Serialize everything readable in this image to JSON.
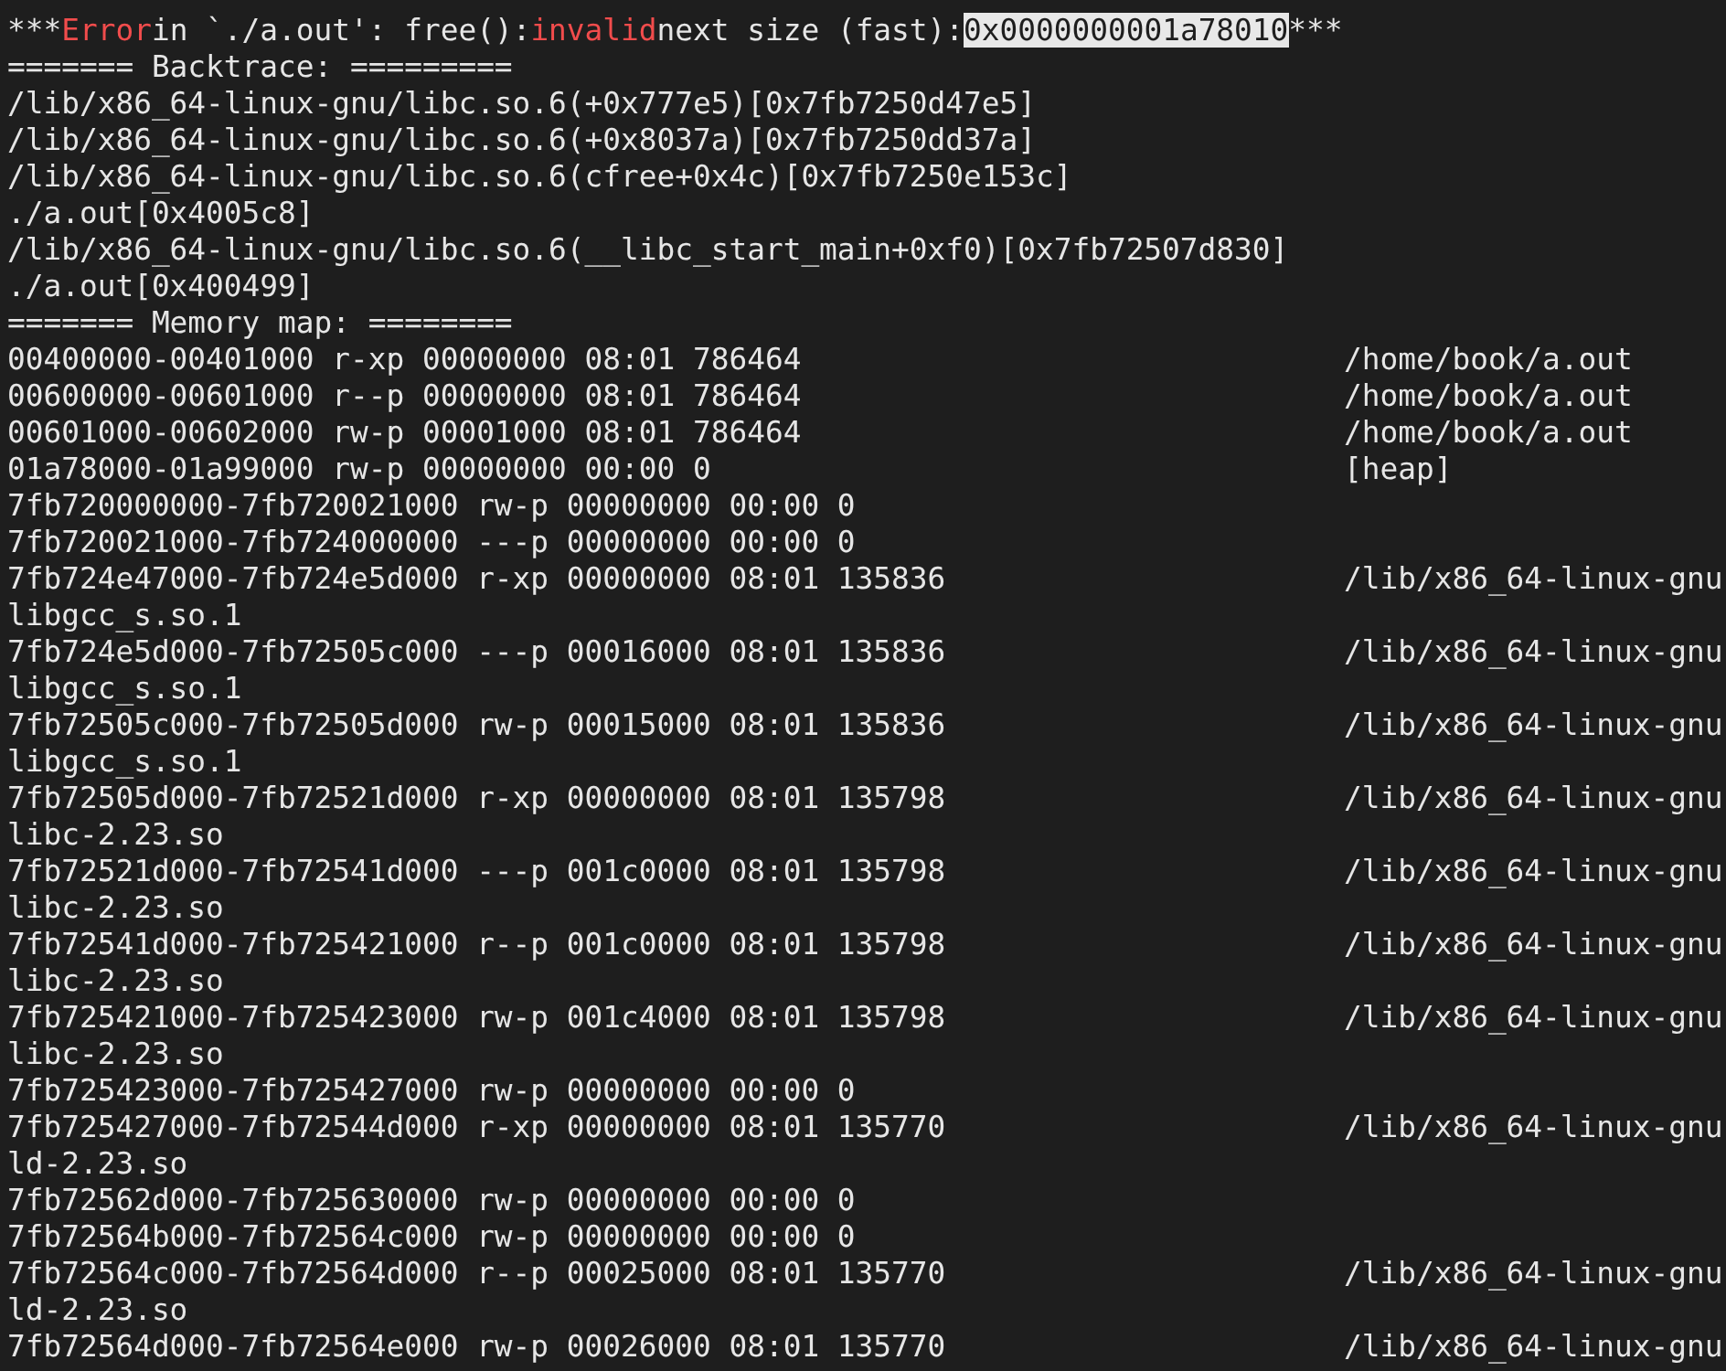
{
  "terminal": {
    "error_line": [
      {
        "text": "***",
        "kind": "plain"
      },
      {
        "text": "Error",
        "kind": "error"
      },
      {
        "text": "in `./a.out': free():",
        "kind": "plain"
      },
      {
        "text": "invalid",
        "kind": "error"
      },
      {
        "text": "next size (fast):",
        "kind": "plain"
      },
      {
        "text": "0x0000000001a78010",
        "kind": "selected"
      },
      {
        "text": "***",
        "kind": "plain"
      }
    ],
    "backtrace": [
      "======= Backtrace: =========",
      "/lib/x86_64-linux-gnu/libc.so.6(+0x777e5)[0x7fb7250d47e5]",
      "/lib/x86_64-linux-gnu/libc.so.6(+0x8037a)[0x7fb7250dd37a]",
      "/lib/x86_64-linux-gnu/libc.so.6(cfree+0x4c)[0x7fb7250e153c]",
      "./a.out[0x4005c8]",
      "/lib/x86_64-linux-gnu/libc.so.6(__libc_start_main+0xf0)[0x7fb72507d830]",
      "./a.out[0x400499]",
      "======= Memory map: ========"
    ],
    "memory_map": [
      {
        "mapping": "00400000-00401000 r-xp 00000000 08:01 786464",
        "path": "/home/book/a.out"
      },
      {
        "mapping": "00600000-00601000 r--p 00000000 08:01 786464",
        "path": "/home/book/a.out"
      },
      {
        "mapping": "00601000-00602000 rw-p 00001000 08:01 786464",
        "path": "/home/book/a.out"
      },
      {
        "mapping": "01a78000-01a99000 rw-p 00000000 00:00 0",
        "path": "[heap]"
      },
      {
        "mapping": "7fb720000000-7fb720021000 rw-p 00000000 00:00 0"
      },
      {
        "mapping": "7fb720021000-7fb724000000 ---p 00000000 00:00 0"
      },
      {
        "mapping": "7fb724e47000-7fb724e5d000 r-xp 00000000 08:01 135836",
        "path": "/lib/x86_64-linux-gnu",
        "wrap": "libgcc_s.so.1"
      },
      {
        "mapping": "7fb724e5d000-7fb72505c000 ---p 00016000 08:01 135836",
        "path": "/lib/x86_64-linux-gnu",
        "wrap": "libgcc_s.so.1"
      },
      {
        "mapping": "7fb72505c000-7fb72505d000 rw-p 00015000 08:01 135836",
        "path": "/lib/x86_64-linux-gnu",
        "wrap": "libgcc_s.so.1"
      },
      {
        "mapping": "7fb72505d000-7fb72521d000 r-xp 00000000 08:01 135798",
        "path": "/lib/x86_64-linux-gnu",
        "wrap": "libc-2.23.so"
      },
      {
        "mapping": "7fb72521d000-7fb72541d000 ---p 001c0000 08:01 135798",
        "path": "/lib/x86_64-linux-gnu",
        "wrap": "libc-2.23.so"
      },
      {
        "mapping": "7fb72541d000-7fb725421000 r--p 001c0000 08:01 135798",
        "path": "/lib/x86_64-linux-gnu",
        "wrap": "libc-2.23.so"
      },
      {
        "mapping": "7fb725421000-7fb725423000 rw-p 001c4000 08:01 135798",
        "path": "/lib/x86_64-linux-gnu",
        "wrap": "libc-2.23.so"
      },
      {
        "mapping": "7fb725423000-7fb725427000 rw-p 00000000 00:00 0"
      },
      {
        "mapping": "7fb725427000-7fb72544d000 r-xp 00000000 08:01 135770",
        "path": "/lib/x86_64-linux-gnu",
        "wrap": "ld-2.23.so"
      },
      {
        "mapping": "7fb72562d000-7fb725630000 rw-p 00000000 00:00 0"
      },
      {
        "mapping": "7fb72564b000-7fb72564c000 rw-p 00000000 00:00 0"
      },
      {
        "mapping": "7fb72564c000-7fb72564d000 r--p 00025000 08:01 135770",
        "path": "/lib/x86_64-linux-gnu",
        "wrap": "ld-2.23.so"
      },
      {
        "mapping": "7fb72564d000-7fb72564e000 rw-p 00026000 08:01 135770",
        "path": "/lib/x86_64-linux-gnu"
      }
    ]
  }
}
